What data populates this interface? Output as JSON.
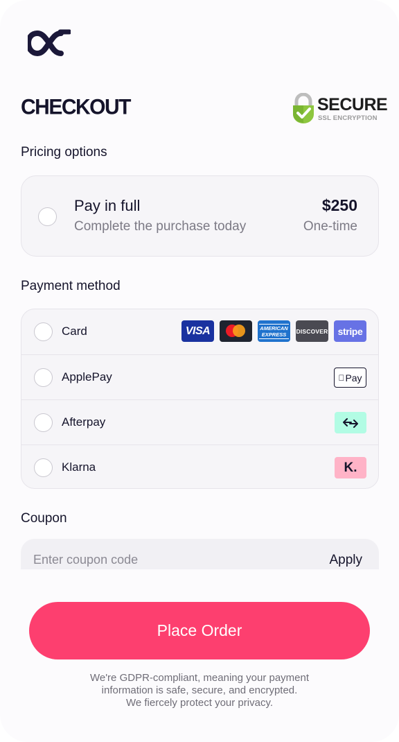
{
  "header": {
    "title": "CHECKOUT",
    "secure_badge": {
      "title": "SECURE",
      "subtitle": "SSL ENCRYPTION",
      "icon": "padlock-check-icon",
      "color": "#8dc63f"
    },
    "logo_icon": "brand-logo-icon"
  },
  "pricing": {
    "label": "Pricing options",
    "options": [
      {
        "name": "Pay in full",
        "description": "Complete the purchase today",
        "price": "$250",
        "frequency": "One-time",
        "selected": false
      }
    ]
  },
  "payment": {
    "label": "Payment method",
    "methods": [
      {
        "label": "Card",
        "logos": [
          "VISA",
          "mastercard-icon",
          "AMERICAN EXPRESS",
          "DISCOVER",
          "stripe"
        ]
      },
      {
        "label": "ApplePay",
        "logo_text": "Pay",
        "icon": "apple-pay-icon"
      },
      {
        "label": "Afterpay",
        "icon": "afterpay-icon",
        "color": "#b2fce4"
      },
      {
        "label": "Klarna",
        "logo_text": "K.",
        "color": "#ffb3c7"
      }
    ]
  },
  "coupon": {
    "label": "Coupon",
    "placeholder": "Enter coupon code",
    "value": "",
    "apply_label": "Apply"
  },
  "footer": {
    "button_label": "Place Order",
    "button_color": "#fd3f6f",
    "disclaimer_lines": [
      "We're GDPR-compliant, meaning your payment",
      "information is safe, secure, and encrypted.",
      "We fiercely protect your privacy."
    ]
  }
}
